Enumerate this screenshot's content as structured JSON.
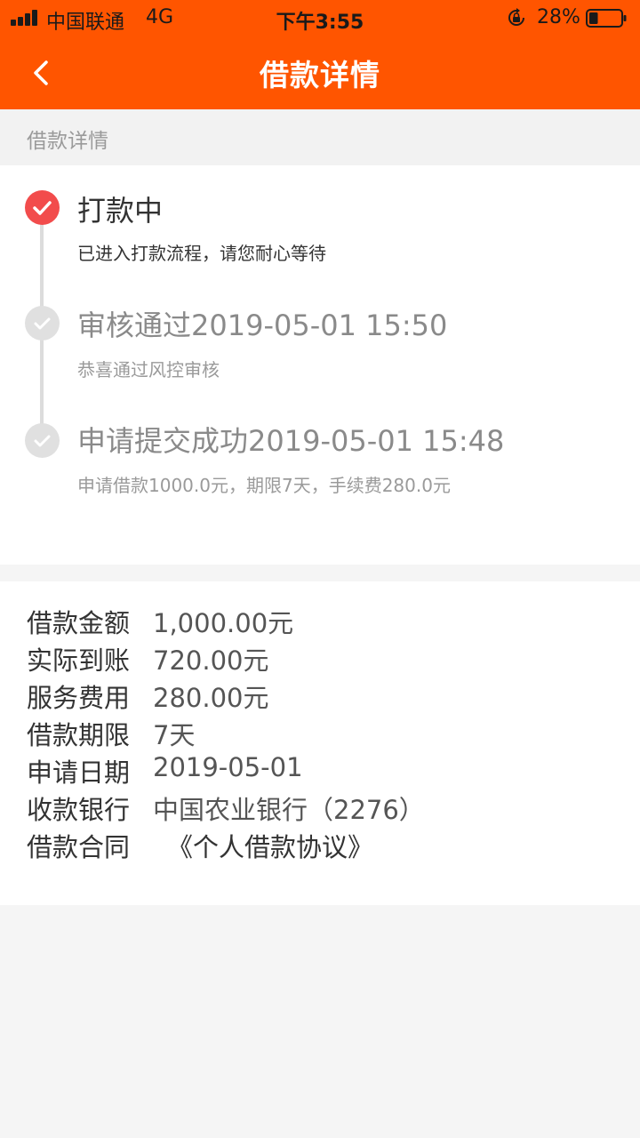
{
  "status_bar": {
    "carrier": "中国联通",
    "network": "4G",
    "time": "下午3:55",
    "battery_percent": "28%",
    "battery_level": 0.28,
    "icons": [
      "signal-icon",
      "orientation-lock-icon",
      "battery-icon"
    ]
  },
  "nav": {
    "back_icon": "chevron-left-icon",
    "title": "借款详情"
  },
  "section": {
    "header": "借款详情"
  },
  "timeline": [
    {
      "title": "打款中",
      "subtitle": "已进入打款流程，请您耐心等待",
      "state": "active"
    },
    {
      "title": "审核通过2019-05-01 15:50",
      "subtitle": "恭喜通过风控审核",
      "state": "done"
    },
    {
      "title": "申请提交成功2019-05-01 15:48",
      "subtitle": "申请借款1000.0元，期限7天，手续费280.0元",
      "state": "done"
    }
  ],
  "details": [
    {
      "label": "借款金额",
      "value": "1,000.00元"
    },
    {
      "label": "实际到账",
      "value": "720.00元"
    },
    {
      "label": "服务费用",
      "value": "280.00元"
    },
    {
      "label": "借款期限",
      "value": "7天"
    },
    {
      "label": "申请日期",
      "value": "2019-05-01"
    },
    {
      "label": "收款银行",
      "value": "中国农业银行（2276）"
    },
    {
      "label": "借款合同",
      "value": "《个人借款协议》"
    }
  ],
  "colors": {
    "brand": "#ff5500",
    "active_dot": "#f24c4c",
    "done_dot": "#e0e0e0",
    "line": "#dcdcdc"
  }
}
